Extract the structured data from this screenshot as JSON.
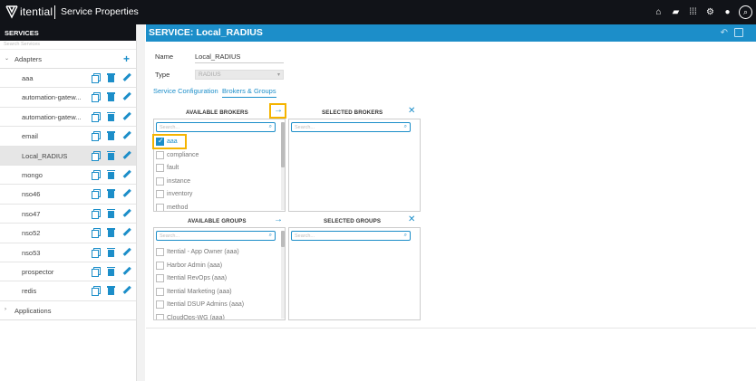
{
  "topbar": {
    "brand": "itential",
    "title": "Service Properties",
    "icons": [
      "home-icon",
      "briefcase-icon",
      "apps-grid-icon",
      "gear-icon",
      "user-icon",
      "search-icon"
    ]
  },
  "sidebar": {
    "header": "SERVICES",
    "search_placeholder": "Search Services",
    "adapters_label": "Adapters",
    "applications_label": "Applications",
    "items": [
      "aaa",
      "automation-gatew...",
      "automation-gatew...",
      "email",
      "Local_RADIUS",
      "mongo",
      "nso46",
      "nso47",
      "nso52",
      "nso53",
      "prospector",
      "redis"
    ],
    "selected": "Local_RADIUS"
  },
  "main": {
    "title": "SERVICE: Local_RADIUS",
    "name_label": "Name",
    "name_value": "Local_RADIUS",
    "type_label": "Type",
    "type_value": "RADIUS",
    "tabs": [
      "Service Configuration",
      "Brokers & Groups"
    ],
    "active_tab": "Brokers & Groups"
  },
  "brokers": {
    "available_title": "AVAILABLE BROKERS",
    "selected_title": "SELECTED BROKERS",
    "search_placeholder": "Search...",
    "items": [
      {
        "label": "aaa",
        "checked": true
      },
      {
        "label": "compliance",
        "checked": false
      },
      {
        "label": "fault",
        "checked": false
      },
      {
        "label": "instance",
        "checked": false
      },
      {
        "label": "inventory",
        "checked": false
      },
      {
        "label": "method",
        "checked": false
      }
    ]
  },
  "groups": {
    "available_title": "AVAILABLE GROUPS",
    "selected_title": "SELECTED GROUPS",
    "search_placeholder": "Search...",
    "items": [
      {
        "label": "Itential - App Owner (aaa)",
        "checked": false
      },
      {
        "label": "Harbor Admin (aaa)",
        "checked": false
      },
      {
        "label": "Itential RevOps (aaa)",
        "checked": false
      },
      {
        "label": "Itential Marketing (aaa)",
        "checked": false
      },
      {
        "label": "Itential DSUP Admins (aaa)",
        "checked": false
      },
      {
        "label": "CloudOps-WG (aaa)",
        "checked": false
      }
    ]
  },
  "colors": {
    "accent": "#1c8ec9",
    "topbar": "#111318",
    "highlight": "#f5b400"
  }
}
